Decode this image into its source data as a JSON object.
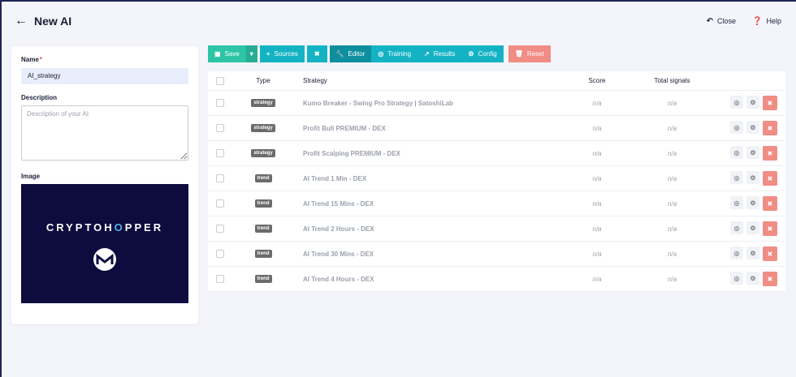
{
  "header": {
    "title": "New AI",
    "back_icon": "arrow-left-icon",
    "close_label": "Close",
    "help_label": "Help"
  },
  "form": {
    "name_label": "Name",
    "name_required_mark": "*",
    "name_value": "AI_strategy",
    "description_label": "Description",
    "description_placeholder": "Description of your AI",
    "image_label": "Image",
    "image_brand": "CRYPTOHOPPER"
  },
  "toolbar": {
    "save_label": "Save",
    "sources_label": "Sources",
    "editor_label": "Editor",
    "training_label": "Training",
    "results_label": "Results",
    "config_label": "Config",
    "reset_label": "Reset"
  },
  "table": {
    "headers": {
      "type": "Type",
      "strategy": "Strategy",
      "score": "Score",
      "signals": "Total signals"
    },
    "rows": [
      {
        "type": "strategy",
        "name": "Kumo Breaker - Swing Pro Strategy | SatoshiLab",
        "score": "n/a",
        "signals": "n/a"
      },
      {
        "type": "strategy",
        "name": "Profit Bull PREMIUM - DEX",
        "score": "n/a",
        "signals": "n/a"
      },
      {
        "type": "strategy",
        "name": "Profit Scalping PREMIUM - DEX",
        "score": "n/a",
        "signals": "n/a"
      },
      {
        "type": "trend",
        "name": "AI Trend 1 Min - DEX",
        "score": "n/a",
        "signals": "n/a"
      },
      {
        "type": "trend",
        "name": "AI Trend 15 Mins - DEX",
        "score": "n/a",
        "signals": "n/a"
      },
      {
        "type": "trend",
        "name": "AI Trend 2 Hours - DEX",
        "score": "n/a",
        "signals": "n/a"
      },
      {
        "type": "trend",
        "name": "AI Trend 30 Mins - DEX",
        "score": "n/a",
        "signals": "n/a"
      },
      {
        "type": "trend",
        "name": "AI Trend 4 Hours - DEX",
        "score": "n/a",
        "signals": "n/a"
      }
    ]
  },
  "colors": {
    "accent_green": "#2ec4a6",
    "accent_teal": "#14b3c4",
    "danger": "#f08d85",
    "image_bg": "#0e0b3e"
  }
}
